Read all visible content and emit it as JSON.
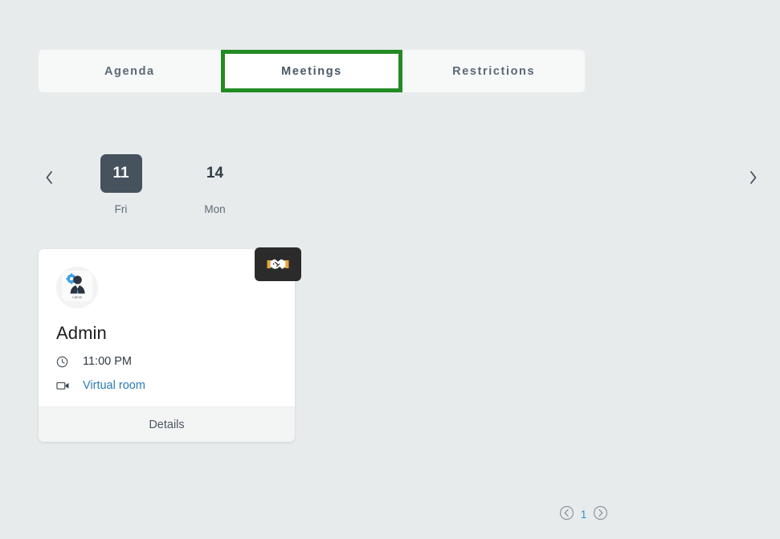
{
  "theme": {
    "page_background": "#e8ebec",
    "tabbar_background": "#f7f8f8",
    "active_tab_background": "#ffffff",
    "highlight_border": "#228B22",
    "selected_day_background": "#46525e",
    "badge_background": "#2b2b2b",
    "link_color": "#2a7ab9",
    "pager_number_color": "#3b8fd4",
    "card_footer_background": "#f3f4f4"
  },
  "tabs": [
    {
      "label": "Agenda",
      "name": "tab-agenda",
      "active": false
    },
    {
      "label": "Meetings",
      "name": "tab-meetings",
      "active": true
    },
    {
      "label": "Restrictions",
      "name": "tab-restrictions",
      "active": false
    }
  ],
  "date_strip": {
    "prev_icon": "chevron-left-icon",
    "next_icon": "chevron-right-icon",
    "days": [
      {
        "number": "11",
        "weekday": "Fri",
        "selected": true
      },
      {
        "number": "14",
        "weekday": "Mon",
        "selected": false
      }
    ]
  },
  "meeting_card": {
    "badge_icon": "handshake-icon",
    "avatar_icon": "admin-user-gear-icon",
    "avatar_caption": "Admin",
    "title": "Admin",
    "time_icon": "clock-icon",
    "time": "11:00 PM",
    "location_icon": "video-camera-icon",
    "location": "Virtual room",
    "details_label": "Details"
  },
  "pagination": {
    "prev_icon": "circle-chevron-left-icon",
    "next_icon": "circle-chevron-right-icon",
    "current_page": "1"
  }
}
